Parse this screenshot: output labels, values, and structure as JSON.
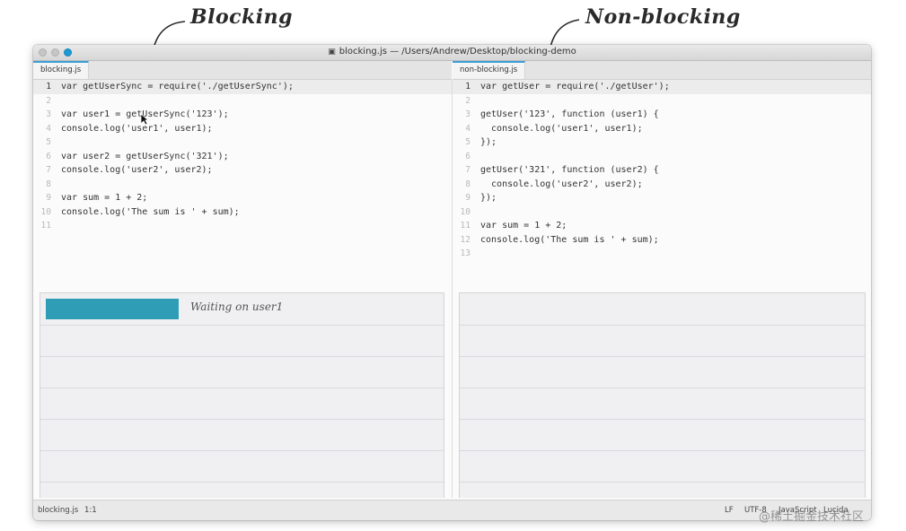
{
  "annotations": {
    "left": "Blocking",
    "right": "Non-blocking"
  },
  "window": {
    "title": "blocking.js — /Users/Andrew/Desktop/blocking-demo"
  },
  "tabs": {
    "left": "blocking.js",
    "right": "non-blocking.js"
  },
  "editor_left": {
    "line_numbers": [
      "1",
      "2",
      "3",
      "4",
      "5",
      "6",
      "7",
      "8",
      "9",
      "10",
      "11"
    ],
    "lines": [
      "var getUserSync = require('./getUserSync');",
      "",
      "var user1 = getUserSync('123');",
      "console.log('user1', user1);",
      "",
      "var user2 = getUserSync('321');",
      "console.log('user2', user2);",
      "",
      "var sum = 1 + 2;",
      "console.log('The sum is ' + sum);",
      ""
    ]
  },
  "editor_right": {
    "line_numbers": [
      "1",
      "2",
      "3",
      "4",
      "5",
      "6",
      "7",
      "8",
      "9",
      "10",
      "11",
      "12",
      "13"
    ],
    "lines": [
      "var getUser = require('./getUser');",
      "",
      "getUser('123', function (user1) {",
      "  console.log('user1', user1);",
      "});",
      "",
      "getUser('321', function (user2) {",
      "  console.log('user2', user2);",
      "});",
      "",
      "var sum = 1 + 2;",
      "console.log('The sum is ' + sum);",
      ""
    ]
  },
  "timeline_left": {
    "bar_label": "Waiting on user1",
    "bar_progress": 0.33,
    "ticks": [
      "1",
      "2",
      "3",
      "4",
      "5",
      "6",
      "7"
    ]
  },
  "timeline_right": {
    "ticks": [
      "1",
      "2",
      "3",
      "4",
      "5",
      "6",
      "7"
    ]
  },
  "status": {
    "file": "blocking.js",
    "position": "1:1",
    "line_ending": "LF",
    "encoding": "UTF-8",
    "grammar": "JavaScript",
    "extra": "Lucida"
  },
  "watermark": "@稀土掘金技术社区",
  "colors": {
    "bar": "#2f9db5",
    "tab_accent": "#3b9fd6"
  }
}
